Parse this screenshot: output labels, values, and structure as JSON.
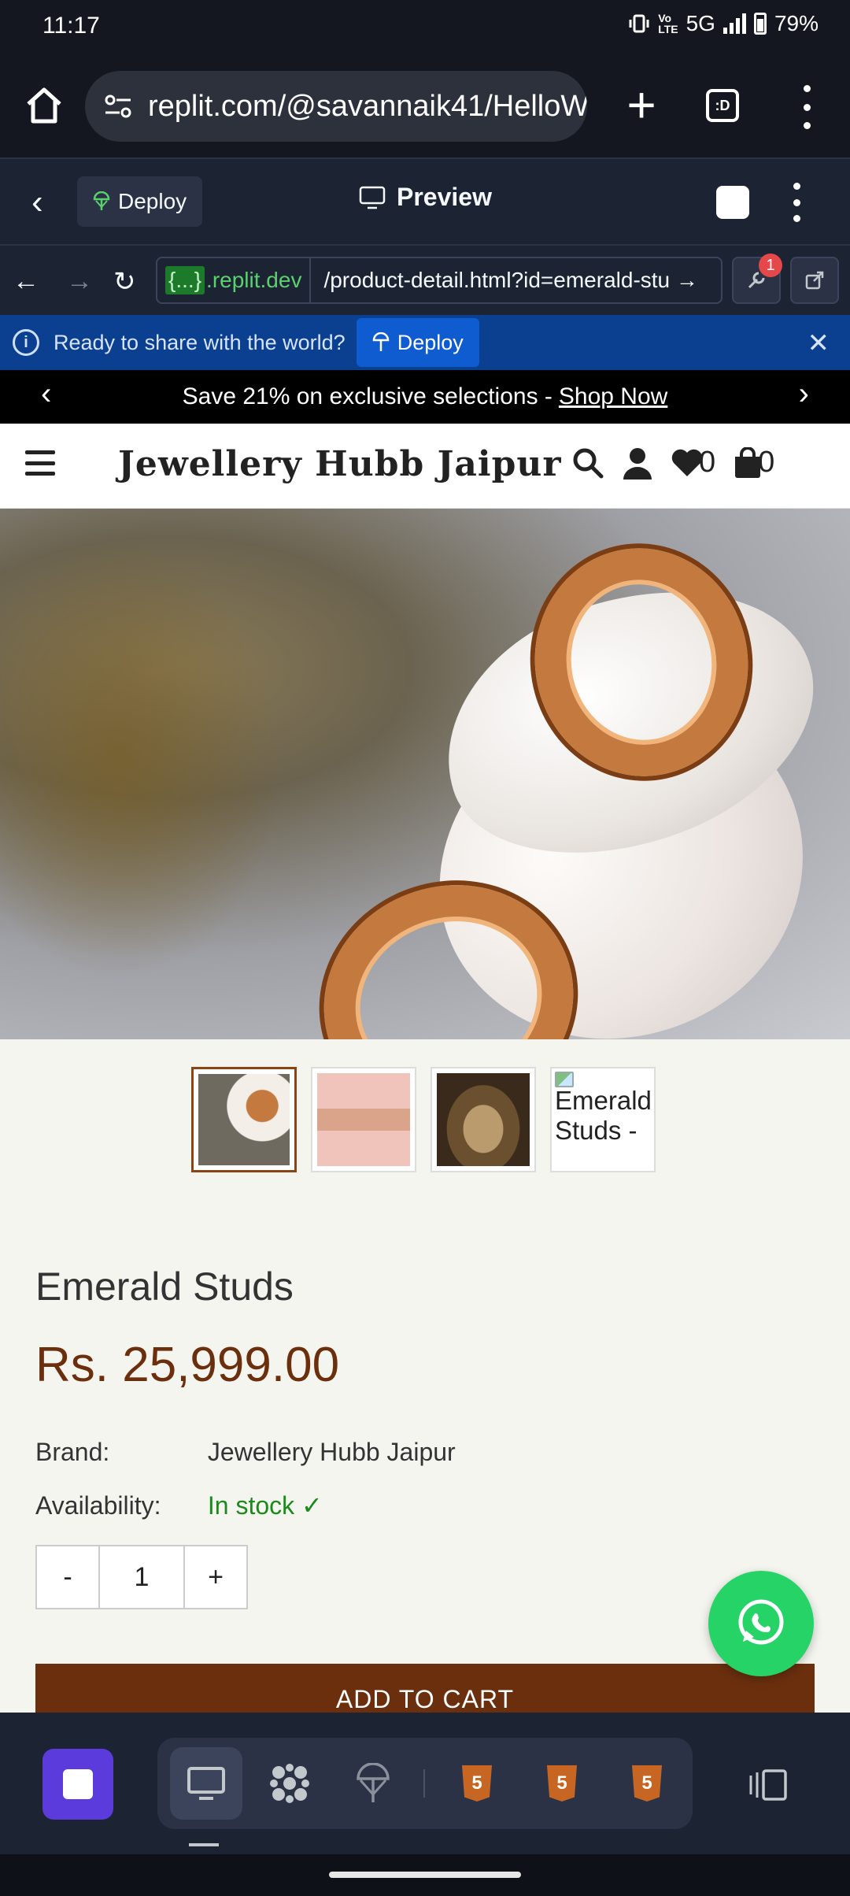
{
  "status_bar": {
    "time": "11:17",
    "network": "5G",
    "battery": "79%"
  },
  "browser": {
    "url": "replit.com/@savannaik41/HelloW",
    "tabs_label": ":D"
  },
  "replit": {
    "deploy_label": "Deploy",
    "preview_title": "Preview",
    "domain": ".replit.dev",
    "domain_token": "{...}",
    "path": "/product-detail.html?id=emerald-stu →",
    "badge_count": "1",
    "banner_message": "Ready to share with the world?",
    "banner_deploy_label": "Deploy"
  },
  "site": {
    "promo_text": "Save 21% on exclusive selections -",
    "promo_link": "Shop Now",
    "brand": "Jewellery Hubb Jaipur",
    "wishlist_count": "0",
    "cart_count": "0",
    "broken_thumb_alt": "Emerald Studs -",
    "product": {
      "name": "Emerald Studs",
      "price": "Rs. 25,999.00",
      "brand_label": "Brand:",
      "brand_value": "Jewellery Hubb Jaipur",
      "availability_label": "Availability:",
      "availability_value": "In stock ✓",
      "qty_minus": "-",
      "qty_value": "1",
      "qty_plus": "+",
      "add_to_cart": "ADD TO CART"
    }
  },
  "icons": {
    "html5_letter": "5"
  },
  "colors": {
    "accent_brown": "#6b2f0e",
    "replit_bg": "#1c2333",
    "banner_blue": "#0b3f8f",
    "whatsapp_green": "#25d366",
    "in_stock_green": "#1b8a1b"
  }
}
